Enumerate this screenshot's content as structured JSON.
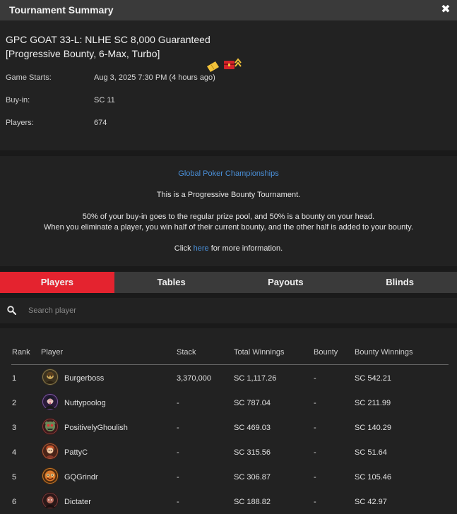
{
  "window": {
    "title": "Tournament Summary",
    "close_label": "✖"
  },
  "tournament": {
    "name_line1": "GPC GOAT 33-L: NLHE SC 8,000 Guaranteed",
    "name_line2": "[Progressive Bounty, 6-Max, Turbo]",
    "icons": [
      "ticket-icon",
      "bounty-chest-icon"
    ],
    "details": {
      "game_starts_label": "Game Starts:",
      "game_starts_value": "Aug 3, 2025 7:30 PM (4 hours ago)",
      "buyin_label": "Buy-in:",
      "buyin_value": "SC 11",
      "players_label": "Players:",
      "players_value": "674"
    }
  },
  "description": {
    "link_title": "Global Poker Championships",
    "line1": "This is a Progressive Bounty Tournament.",
    "line2": "50% of your buy-in goes to the regular prize pool, and 50% is a bounty on your head.",
    "line3": "When you eliminate a player, you win half of their current bounty, and the other half is added to your bounty.",
    "line4_prefix": "Click ",
    "line4_link": "here",
    "line4_suffix": " for more information."
  },
  "tabs": [
    {
      "label": "Players",
      "active": true
    },
    {
      "label": "Tables",
      "active": false
    },
    {
      "label": "Payouts",
      "active": false
    },
    {
      "label": "Blinds",
      "active": false
    }
  ],
  "search": {
    "placeholder": "Search player",
    "value": ""
  },
  "table": {
    "headers": {
      "rank": "Rank",
      "player": "Player",
      "stack": "Stack",
      "total_winnings": "Total Winnings",
      "bounty": "Bounty",
      "bounty_winnings": "Bounty Winnings"
    },
    "rows": [
      {
        "rank": "1",
        "player": "Burgerboss",
        "stack": "3,370,000",
        "total_winnings": "SC 1,117.26",
        "bounty": "-",
        "bounty_winnings": "SC 542.21"
      },
      {
        "rank": "2",
        "player": "Nuttypoolog",
        "stack": "-",
        "total_winnings": "SC 787.04",
        "bounty": "-",
        "bounty_winnings": "SC 211.99"
      },
      {
        "rank": "3",
        "player": "PositivelyGhoulish",
        "stack": "-",
        "total_winnings": "SC 469.03",
        "bounty": "-",
        "bounty_winnings": "SC 140.29"
      },
      {
        "rank": "4",
        "player": "PattyC",
        "stack": "-",
        "total_winnings": "SC 315.56",
        "bounty": "-",
        "bounty_winnings": "SC 51.64"
      },
      {
        "rank": "5",
        "player": "GQGrindr",
        "stack": "-",
        "total_winnings": "SC 306.87",
        "bounty": "-",
        "bounty_winnings": "SC 105.46"
      },
      {
        "rank": "6",
        "player": "Dictater",
        "stack": "-",
        "total_winnings": "SC 188.82",
        "bounty": "-",
        "bounty_winnings": "SC 42.97"
      }
    ]
  },
  "colors": {
    "accent_red": "#e4232f",
    "link_blue": "#4a90d9",
    "panel_bg": "#222222",
    "page_bg": "#1a1a1a",
    "titlebar_bg": "#3a3a3a"
  }
}
